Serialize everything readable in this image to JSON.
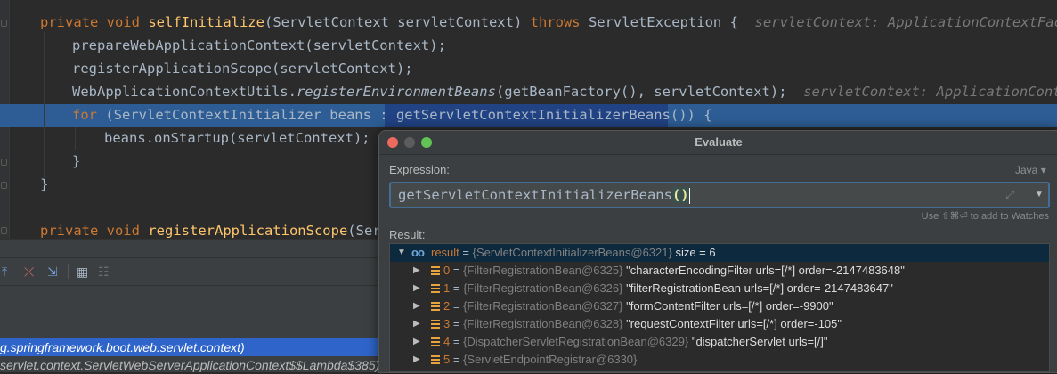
{
  "editor": {
    "lines": [
      {
        "id": "l1",
        "parts": [
          {
            "t": "private void ",
            "c": "kw"
          },
          {
            "t": "selfInitialize",
            "c": "fn"
          },
          {
            "t": "(ServletContext servletContext) "
          },
          {
            "t": "throws ",
            "c": "kw"
          },
          {
            "t": "ServletException {"
          },
          {
            "t": "  servletContext: ApplicationContextFacade@",
            "c": "hint"
          }
        ]
      },
      {
        "id": "l2",
        "parts": [
          {
            "t": "prepareWebApplicationContext(servletContext);"
          }
        ]
      },
      {
        "id": "l3",
        "parts": [
          {
            "t": "registerApplicationScope(servletContext);"
          }
        ]
      },
      {
        "id": "l4",
        "parts": [
          {
            "t": "WebApplicationContextUtils."
          },
          {
            "t": "registerEnvironmentBeans",
            "c": "it"
          },
          {
            "t": "(getBeanFactory(), servletContext);"
          },
          {
            "t": "  servletContext: ApplicationContextF",
            "c": "hint"
          }
        ]
      },
      {
        "id": "l5",
        "parts": [
          {
            "t": "for ",
            "c": "kw"
          },
          {
            "t": "(ServletContextInitializer beans : getServletContextInitializerBeans()) {"
          }
        ]
      },
      {
        "id": "l6",
        "parts": [
          {
            "t": "beans.onStartup(servletContext);"
          }
        ]
      },
      {
        "id": "l7",
        "parts": [
          {
            "t": "}"
          }
        ]
      },
      {
        "id": "l8",
        "parts": [
          {
            "t": "}"
          }
        ]
      },
      {
        "id": "l9",
        "parts": [
          {
            "t": "private void ",
            "c": "kw"
          },
          {
            "t": "registerApplicationScope",
            "c": "fn"
          },
          {
            "t": "(Serv"
          }
        ]
      }
    ]
  },
  "debug": {
    "frames": [
      {
        "text": "g.springframework.boot.web.servlet.context)",
        "selected": true
      },
      {
        "text": "servlet.context.ServletWebServerApplicationContext$$Lambda$385)",
        "selected": false
      }
    ]
  },
  "dialog": {
    "title": "Evaluate",
    "expression_label": "Expression:",
    "language": "Java",
    "expression_main": "getServletContextInitializerBeans",
    "expression_parens": "()",
    "watches_hint": "Use ⇧⌘⏎ to add to Watches",
    "result_label": "Result:",
    "result": {
      "glyph": "oo",
      "name": "result",
      "eq": " = ",
      "type": "{ServletContextInitializerBeans@6321}",
      "extra": "  size = 6"
    },
    "items": [
      {
        "index": "0",
        "type": "{FilterRegistrationBean@6325}",
        "value": "\"characterEncodingFilter urls=[/*] order=-2147483648\""
      },
      {
        "index": "1",
        "type": "{FilterRegistrationBean@6326}",
        "value": "\"filterRegistrationBean urls=[/*] order=-2147483647\""
      },
      {
        "index": "2",
        "type": "{FilterRegistrationBean@6327}",
        "value": "\"formContentFilter urls=[/*] order=-9900\""
      },
      {
        "index": "3",
        "type": "{FilterRegistrationBean@6328}",
        "value": "\"requestContextFilter urls=[/*] order=-105\""
      },
      {
        "index": "4",
        "type": "{DispatcherServletRegistrationBean@6329}",
        "value": "\"dispatcherServlet urls=[/]\""
      },
      {
        "index": "5",
        "type": "{ServletEndpointRegistrar@6330}",
        "value": ""
      }
    ]
  },
  "colors": {
    "accent": "#2d5d94",
    "selection": "#214283",
    "keyword": "#cc7832",
    "function": "#ffc66d"
  }
}
